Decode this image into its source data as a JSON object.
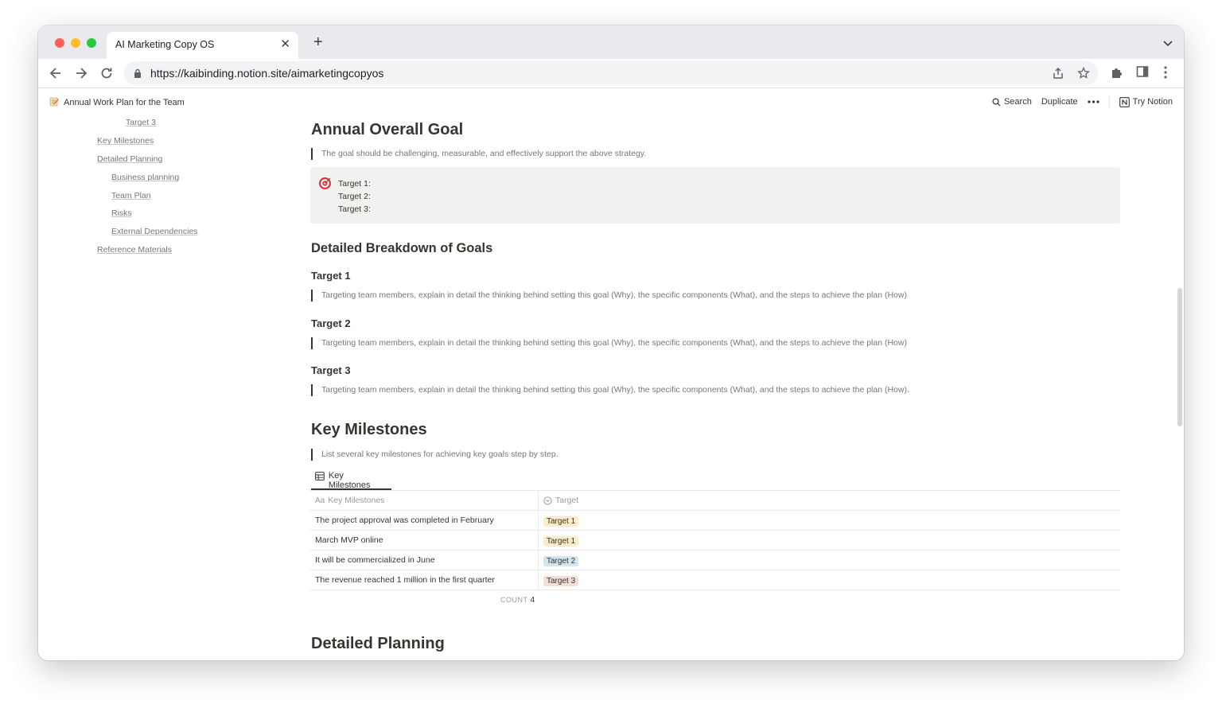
{
  "browser": {
    "tab_title": "AI Marketing Copy OS",
    "url": "https://kaibinding.notion.site/aimarketingcopyos"
  },
  "notion_bar": {
    "page_title": "Annual Work Plan for the Team",
    "search": "Search",
    "duplicate": "Duplicate",
    "try_notion": "Try Notion"
  },
  "toc": [
    {
      "label": "Target 3",
      "level": 3
    },
    {
      "label": "Key Milestones",
      "level": 1
    },
    {
      "label": "Detailed Planning",
      "level": 1
    },
    {
      "label": "Business planning",
      "level": 2
    },
    {
      "label": "Team Plan",
      "level": 2
    },
    {
      "label": "Risks",
      "level": 2
    },
    {
      "label": "External Dependencies",
      "level": 2
    },
    {
      "label": "Reference Materials",
      "level": 1
    }
  ],
  "content": {
    "annual_goal": {
      "heading": "Annual Overall Goal",
      "quote": "The goal should be challenging, measurable, and effectively support the above strategy.",
      "callout_lines": [
        "Target 1:",
        "Target 2:",
        "Target 3:"
      ]
    },
    "breakdown": {
      "heading": "Detailed Breakdown of Goals",
      "targets": [
        {
          "title": "Target 1",
          "text": "Targeting team members, explain in detail the thinking behind setting this goal (Why), the specific components (What), and the steps to achieve the plan (How)"
        },
        {
          "title": "Target 2",
          "text": "Targeting team members, explain in detail the thinking behind setting this goal (Why), the specific components (What), and the steps to achieve the plan (How)"
        },
        {
          "title": "Target 3",
          "text": "Targeting team members, explain in detail the thinking behind setting this goal (Why), the specific components (What), and the steps to achieve the plan (How)."
        }
      ]
    },
    "milestones": {
      "heading": "Key Milestones",
      "quote": "List several key milestones for achieving key goals step by step.",
      "db_tab": "Key Milestones",
      "columns": [
        "Key Milestones",
        "Target"
      ],
      "rows": [
        {
          "name": "The project approval was completed in February",
          "tag": "Target 1",
          "tag_color": "#fdecc8"
        },
        {
          "name": "March MVP online",
          "tag": "Target 1",
          "tag_color": "#fdecc8"
        },
        {
          "name": "It will be commercialized in June",
          "tag": "Target 2",
          "tag_color": "#d3e5ef"
        },
        {
          "name": "The revenue reached 1 million in the first quarter",
          "tag": "Target 3",
          "tag_color": "#f4dfd7"
        }
      ],
      "count_label": "COUNT",
      "count_value": "4"
    },
    "detailed_planning": {
      "heading": "Detailed Planning"
    }
  }
}
